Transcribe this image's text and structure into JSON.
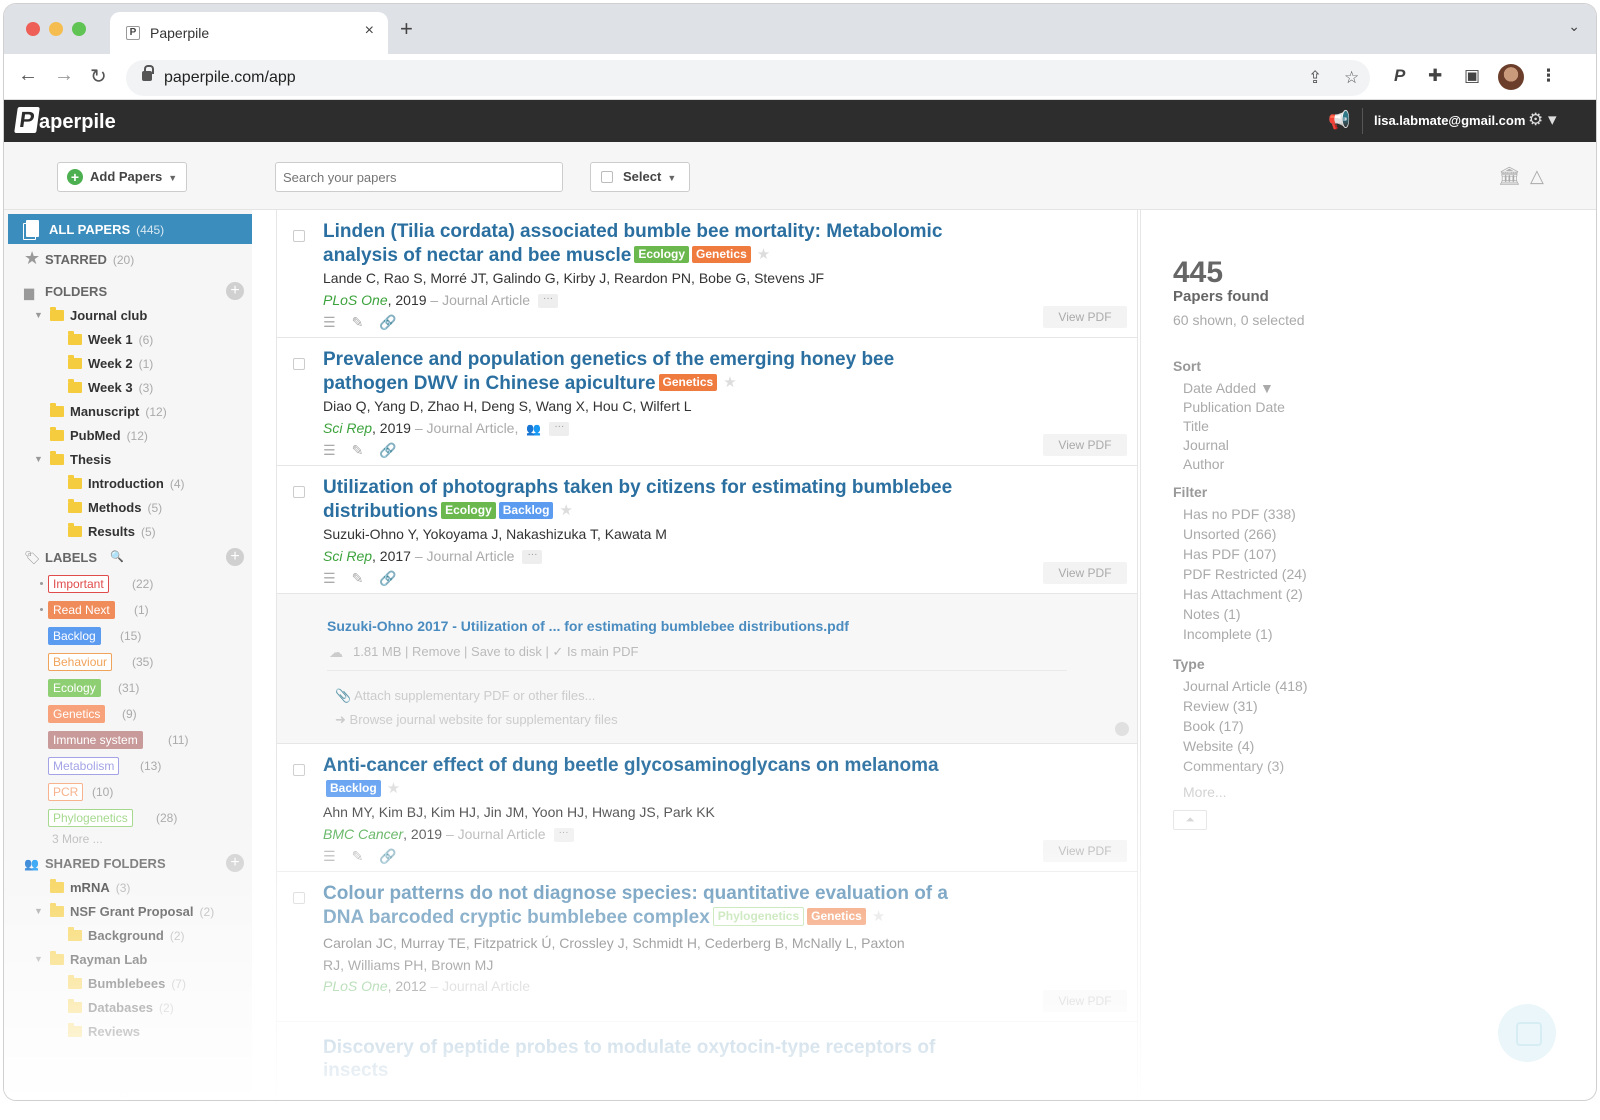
{
  "browser": {
    "tab_title": "Paperpile",
    "tab_favicon": "P",
    "tab_close": "×",
    "new_tab": "+",
    "tab_chevron": "⌄",
    "back": "←",
    "forward": "→",
    "reload": "↻",
    "url": "paperpile.com/app",
    "share_icon": "⇪",
    "bookmark_icon": "☆",
    "paperpile_ext": "P",
    "extensions_icon": "✚",
    "sidepanel_icon": "▣",
    "menu_icon": "⋮"
  },
  "header": {
    "logo_mark": "P",
    "logo_text": "aperpile",
    "megaphone_icon": "📢",
    "email": "lisa.labmate@gmail.com",
    "gear_icon": "⚙ ▾"
  },
  "toolbar": {
    "add_papers": "Add Papers",
    "add_icon": "+",
    "caret": "▼",
    "search_placeholder": "Search your papers",
    "select": "Select",
    "library_icon": "🏛",
    "drive_icon": "△"
  },
  "sidebar": {
    "all_papers": {
      "label": "ALL PAPERS",
      "count": "(445)"
    },
    "starred": {
      "label": "STARRED",
      "count": "(20)",
      "icon": "★"
    },
    "folders_label": "FOLDERS",
    "folder_icon": "▆",
    "add": "+",
    "folders": [
      {
        "name": "Journal club",
        "count": "",
        "toggle": "▼"
      },
      {
        "name": "Week 1",
        "count": "(6)"
      },
      {
        "name": "Week 2",
        "count": "(1)"
      },
      {
        "name": "Week 3",
        "count": "(3)"
      },
      {
        "name": "Manuscript",
        "count": "(12)"
      },
      {
        "name": "PubMed",
        "count": "(12)"
      },
      {
        "name": "Thesis",
        "count": "",
        "toggle": "▼"
      },
      {
        "name": "Introduction",
        "count": "(4)"
      },
      {
        "name": "Methods",
        "count": "(5)"
      },
      {
        "name": "Results",
        "count": "(5)"
      }
    ],
    "labels_label": "LABELS",
    "labels_icon": "🏷",
    "labels_search_icon": "🔍",
    "labels": [
      {
        "name": "Important",
        "count": "(22)"
      },
      {
        "name": "Read Next",
        "count": "(1)"
      },
      {
        "name": "Backlog",
        "count": "(15)"
      },
      {
        "name": "Behaviour",
        "count": "(35)"
      },
      {
        "name": "Ecology",
        "count": "(31)"
      },
      {
        "name": "Genetics",
        "count": "(9)"
      },
      {
        "name": "Immune system",
        "count": "(11)"
      },
      {
        "name": "Metabolism",
        "count": "(13)"
      },
      {
        "name": "PCR",
        "count": "(10)"
      },
      {
        "name": "Phylogenetics",
        "count": "(28)"
      }
    ],
    "more_labels": "3 More ...",
    "shared_label": "SHARED FOLDERS",
    "shared_icon": "👥",
    "shared": [
      {
        "name": "mRNA",
        "count": "(3)"
      },
      {
        "name": "NSF Grant Proposal",
        "count": "(2)",
        "toggle": "▼"
      },
      {
        "name": "Background",
        "count": "(2)"
      },
      {
        "name": "Rayman Lab",
        "count": "",
        "toggle": "▼"
      },
      {
        "name": "Bumblebees",
        "count": "(7)"
      },
      {
        "name": "Databases",
        "count": "(2)"
      },
      {
        "name": "Reviews",
        "count": ""
      }
    ]
  },
  "papers": [
    {
      "title": "Linden (Tilia cordata) associated bumble bee mortality: Metabolomic analysis of nectar and bee muscle",
      "tags": [
        "Ecology",
        "Genetics"
      ],
      "authors": "Lande C, Rao S, Morré JT, Galindo G, Kirby J, Reardon PN, Bobe G, Stevens JF",
      "journal": "PLoS One",
      "year": ", 2019",
      "type": " – Journal Article",
      "view_pdf": "View PDF"
    },
    {
      "title": "Prevalence and population genetics of the emerging honey bee pathogen DWV in Chinese apiculture",
      "tags": [
        "Genetics"
      ],
      "authors": "Diao Q, Yang D, Zhao H, Deng S, Wang X, Hou C, Wilfert L",
      "journal": "Sci Rep",
      "year": ", 2019",
      "type": " – Journal Article,",
      "view_pdf": "View PDF"
    },
    {
      "title": "Utilization of photographs taken by citizens for estimating bumblebee distributions",
      "tags": [
        "Ecology",
        "Backlog"
      ],
      "authors": "Suzuki-Ohno Y, Yokoyama J, Nakashizuka T, Kawata M",
      "journal": "Sci Rep",
      "year": ", 2017",
      "type": " – Journal Article",
      "view_pdf": "View PDF"
    },
    {
      "title": "Anti-cancer effect of dung beetle glycosaminoglycans on melanoma",
      "tags": [
        "Backlog"
      ],
      "authors": "Ahn MY, Kim BJ, Kim HJ, Jin JM, Yoon HJ, Hwang JS, Park KK",
      "journal": "BMC Cancer",
      "year": ", 2019",
      "type": " – Journal Article",
      "view_pdf": "View PDF"
    },
    {
      "title": "Colour patterns do not diagnose species: quantitative evaluation of a DNA barcoded cryptic bumblebee complex",
      "tags": [
        "Phylogenetics",
        "Genetics"
      ],
      "authors": "Carolan JC, Murray TE, Fitzpatrick Ú, Crossley J, Schmidt H, Cederberg B, McNally L, Paxton RJ, Williams PH, Brown MJ",
      "journal": "PLoS One",
      "year": ", 2012",
      "type": " – Journal Article",
      "view_pdf": "View PDF"
    },
    {
      "title": "Discovery of peptide probes to modulate oxytocin-type receptors of insects",
      "tags": [],
      "authors": "",
      "journal": "",
      "year": "",
      "type": "",
      "view_pdf": ""
    }
  ],
  "paper_icons": {
    "notes": "☰",
    "edit": "✎",
    "attach": "🔗",
    "star": "★",
    "ellipsis": "···",
    "people": "👥",
    "attach_count": "1"
  },
  "attachment": {
    "filename": "Suzuki-Ohno 2017 - Utilization of ... for estimating bumblebee distributions.pdf",
    "meta": "1.81 MB | Remove | Save to disk | ✓ Is main PDF",
    "cloud_icon": "☁",
    "supplementary": "Attach supplementary PDF or other files...",
    "browse": "Browse journal website for supplementary files",
    "paperclip": "📎",
    "arrow": "➜"
  },
  "rightpanel": {
    "count": "445",
    "count_label": "Papers found",
    "count_sub": "60 shown, 0 selected",
    "sort_label": "Sort",
    "sort": [
      "Date Added ▼",
      "Publication Date",
      "Title",
      "Journal",
      "Author"
    ],
    "filter_label": "Filter",
    "filter": [
      "Has no PDF (338)",
      "Unsorted (266)",
      "Has PDF (107)",
      "PDF Restricted (24)",
      "Has Attachment (2)",
      "Notes (1)",
      "Incomplete (1)"
    ],
    "type_label": "Type",
    "type": [
      "Journal Article (418)",
      "Review (31)",
      "Book (17)",
      "Website (4)",
      "Commentary (3)"
    ],
    "more": "More...",
    "collapse_icon": "⏶"
  },
  "colors": {
    "accent": "#3b8dbd",
    "title_blue": "#2a6fa0",
    "journal_green": "#3ca33c",
    "ecology": "#6bb84f",
    "genetics": "#f07b3f",
    "backlog": "#5b9bf0",
    "important": "#e04b4b",
    "read_next": "#f08b5a"
  }
}
